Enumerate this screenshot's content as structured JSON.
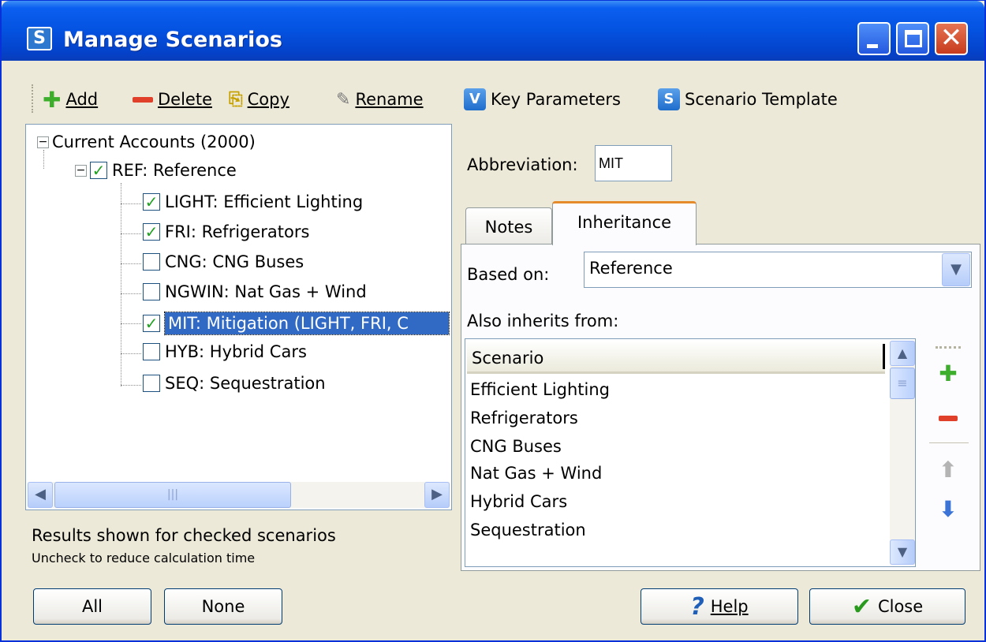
{
  "window": {
    "title": "Manage Scenarios",
    "app_icon_letter": "S"
  },
  "toolbar": {
    "add": "Add",
    "delete": "Delete",
    "copy": "Copy",
    "rename": "Rename",
    "key_parameters": "Key Parameters",
    "key_parameters_icon_letter": "V",
    "scenario_template": "Scenario Template",
    "scenario_template_icon_letter": "S"
  },
  "tree": {
    "root": "Current Accounts (2000)",
    "ref": "REF: Reference",
    "children": [
      {
        "label": "LIGHT: Efficient Lighting",
        "checked": true
      },
      {
        "label": "FRI: Refrigerators",
        "checked": true
      },
      {
        "label": "CNG: CNG Buses",
        "checked": false
      },
      {
        "label": "NGWIN: Nat Gas + Wind",
        "checked": false
      },
      {
        "label": "MIT: Mitigation (LIGHT, FRI, C",
        "checked": true,
        "selected": true
      },
      {
        "label": "HYB: Hybrid Cars",
        "checked": false
      },
      {
        "label": "SEQ: Sequestration",
        "checked": false
      }
    ]
  },
  "status": {
    "line1": "Results shown for checked scenarios",
    "line2": "Uncheck to reduce calculation time"
  },
  "abbreviation": {
    "label": "Abbreviation:",
    "value": "MIT"
  },
  "tabs": {
    "notes": "Notes",
    "inheritance": "Inheritance",
    "active": "Inheritance"
  },
  "inheritance": {
    "based_on_label": "Based on:",
    "based_on_value": "Reference",
    "also_label": "Also inherits from:",
    "column_header": "Scenario",
    "rows": [
      "Efficient Lighting",
      "Refrigerators",
      "CNG Buses",
      "Nat Gas + Wind",
      "Hybrid Cars",
      "Sequestration"
    ]
  },
  "buttons": {
    "all": "All",
    "none": "None",
    "help": "Help",
    "close": "Close"
  },
  "colors": {
    "titlebar": "#0452e0",
    "selection": "#316ac5",
    "check": "#21a121",
    "active_tab_accent": "#e68b2c"
  }
}
